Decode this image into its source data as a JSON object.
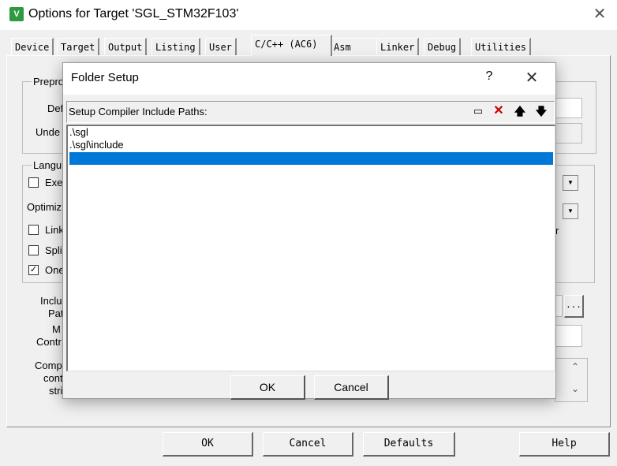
{
  "window": {
    "title": "Options for Target 'SGL_STM32F103'",
    "icon_glyph": "V"
  },
  "tabs": [
    {
      "label": "Device"
    },
    {
      "label": "Target"
    },
    {
      "label": "Output"
    },
    {
      "label": "Listing"
    },
    {
      "label": "User"
    },
    {
      "label": "C/C++ (AC6)"
    },
    {
      "label": "Asm"
    },
    {
      "label": "Linker"
    },
    {
      "label": "Debug"
    },
    {
      "label": "Utilities"
    }
  ],
  "active_tab": "C/C++ (AC6)",
  "background_panel": {
    "preprocessor_group": "Prepro",
    "define_label": "Def",
    "undefine_label": "Unde",
    "language_group": "Langu",
    "exe_label": "Exe",
    "optimize_label": "Optimiz",
    "link_label": "Link",
    "split_label": "Spli",
    "one_label": "One",
    "include_label_1": "Inclu",
    "include_label_2": "Pat",
    "misc_label_1": "M",
    "misc_label_2": "Contr",
    "compiler_label_1": "Comp",
    "compiler_label_2": "cont",
    "compiler_label_3": "stri",
    "stray_text": "r",
    "browse_label": "..."
  },
  "bottom_buttons": {
    "ok": "OK",
    "cancel": "Cancel",
    "defaults": "Defaults",
    "help": "Help"
  },
  "dialog": {
    "title": "Folder Setup",
    "help_glyph": "?",
    "header_label": "Setup Compiler Include Paths:",
    "toolbar": [
      {
        "name": "new-folder-icon",
        "glyph": "▭"
      },
      {
        "name": "delete-icon",
        "glyph": "✕",
        "color": "#cc0000"
      },
      {
        "name": "move-up-icon",
        "glyph": "🡅"
      },
      {
        "name": "move-down-icon",
        "glyph": "🡇"
      }
    ],
    "paths": [
      ".\\sgl",
      ".\\sgl\\include",
      ""
    ],
    "selected_index": 2,
    "ok": "OK",
    "cancel": "Cancel",
    "selection_color": "#0078d7"
  }
}
